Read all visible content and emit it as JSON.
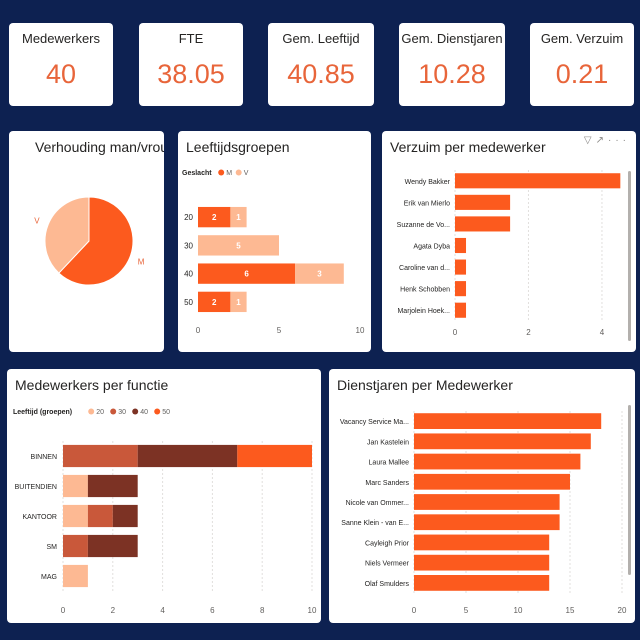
{
  "kpis": [
    {
      "label": "Medewerkers",
      "value": "40"
    },
    {
      "label": "FTE",
      "value": "38.05"
    },
    {
      "label": "Gem. Leeftijd",
      "value": "40.85"
    },
    {
      "label": "Gem. Dienstjaren",
      "value": "10.28"
    },
    {
      "label": "Gem. Verzuim",
      "value": "0.21"
    }
  ],
  "colors": {
    "background": "#0d2151",
    "accent": "#e8653a",
    "orange": "#fc5a1e",
    "light": "#fdb993",
    "mid": "#c9583a",
    "dark": "#7c3224"
  },
  "icons": [
    "filter-icon",
    "focus-mode-icon",
    "more-options-icon"
  ],
  "chart_data": [
    {
      "id": "gender",
      "type": "pie",
      "title": "Verhouding man/vrouw",
      "labels": [
        "M",
        "V"
      ],
      "values": [
        62,
        38
      ],
      "colors": [
        "#fc5a1e",
        "#fdb993"
      ]
    },
    {
      "id": "age",
      "type": "bar",
      "orientation": "horizontal",
      "stacked": true,
      "title": "Leeftijdsgroepen",
      "legend_title": "Geslacht",
      "categories": [
        "20",
        "30",
        "40",
        "50"
      ],
      "series": [
        {
          "name": "M",
          "values": [
            2,
            0,
            6,
            2
          ],
          "color": "#fc5a1e",
          "labels": [
            "2",
            "",
            "6",
            "2"
          ]
        },
        {
          "name": "V",
          "values": [
            1,
            5,
            3,
            1
          ],
          "color": "#fdb993",
          "labels": [
            "1",
            "5",
            "3",
            "1"
          ]
        }
      ],
      "xticks": [
        "0",
        "5",
        "10"
      ],
      "xlim": [
        0,
        10
      ]
    },
    {
      "id": "absence",
      "type": "bar",
      "orientation": "horizontal",
      "title": "Verzuim per medewerker",
      "categories": [
        "Wendy Bakker",
        "Erik van Mierlo",
        "Suzanne de Vo...",
        "Agata Dyba",
        "Caroline van d...",
        "Henk Schobben",
        "Marjolein Hoek..."
      ],
      "values": [
        4.5,
        1.5,
        1.5,
        0.3,
        0.3,
        0.3,
        0.3
      ],
      "color": "#fc5a1e",
      "xticks": [
        "0",
        "2",
        "4"
      ],
      "xlim": [
        0,
        4.6
      ]
    },
    {
      "id": "function",
      "type": "bar",
      "orientation": "horizontal",
      "stacked": true,
      "title": "Medewerkers per functie",
      "legend_title": "Leeftijd (groepen)",
      "categories": [
        "BINNEN",
        "BUITENDIEN",
        "KANTOOR",
        "SM",
        "MAG"
      ],
      "series": [
        {
          "name": "20",
          "values": [
            0,
            1,
            1,
            0,
            1
          ],
          "color": "#fdb993"
        },
        {
          "name": "30",
          "values": [
            3,
            0,
            1,
            1,
            0
          ],
          "color": "#c9583a"
        },
        {
          "name": "40",
          "values": [
            4,
            2,
            1,
            2,
            0
          ],
          "color": "#7c3224"
        },
        {
          "name": "50",
          "values": [
            3,
            0,
            0,
            0,
            0
          ],
          "color": "#fc5a1e"
        }
      ],
      "xticks": [
        "0",
        "2",
        "4",
        "6",
        "8",
        "10"
      ],
      "xlim": [
        0,
        10
      ]
    },
    {
      "id": "tenure",
      "type": "bar",
      "orientation": "horizontal",
      "title": "Dienstjaren per Medewerker",
      "categories": [
        "Vacancy Service Ma...",
        "Jan Kastelein",
        "Laura Mallee",
        "Marc Sanders",
        "Nicole van Ommer...",
        "Sanne Klein - van E...",
        "Cayleigh Prior",
        "Niels Vermeer",
        "Olaf Smulders"
      ],
      "values": [
        18,
        17,
        16,
        15,
        14,
        14,
        13,
        13,
        13
      ],
      "color": "#fc5a1e",
      "xticks": [
        "0",
        "5",
        "10",
        "15",
        "20"
      ],
      "xlim": [
        0,
        20
      ]
    }
  ]
}
